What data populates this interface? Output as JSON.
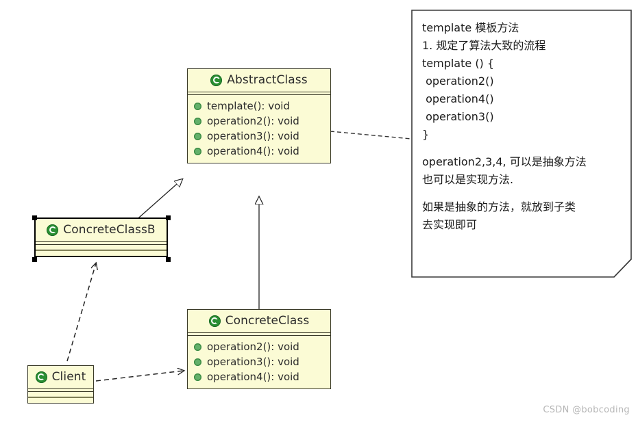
{
  "diagram": {
    "type": "uml-class-diagram",
    "title": "Template Method Pattern UML"
  },
  "classes": [
    {
      "id": "abstract-class",
      "name": "AbstractClass",
      "icon": "class-c-icon",
      "selected": false,
      "members": [
        "template(): void",
        "operation2(): void",
        "operation3(): void",
        "operation4(): void"
      ]
    },
    {
      "id": "concrete-class-b",
      "name": "ConcreteClassB",
      "icon": "class-c-icon",
      "selected": true,
      "members": []
    },
    {
      "id": "concrete-class",
      "name": "ConcreteClass",
      "icon": "class-c-icon",
      "selected": false,
      "members": [
        "operation2(): void",
        "operation3(): void",
        "operation4(): void"
      ]
    },
    {
      "id": "client",
      "name": "Client",
      "icon": "class-c-icon",
      "selected": false,
      "members": []
    }
  ],
  "note": {
    "id": "template-note",
    "lines": [
      "template 模板方法",
      "1. 规定了算法大致的流程",
      "template () {",
      " operation2()",
      " operation4()",
      " operation3()",
      "}",
      "",
      "operation2,3,4, 可以是抽象方法",
      "也可以是实现方法.",
      "",
      "如果是抽象的方法，就放到子类",
      "去实现即可"
    ]
  },
  "relations": [
    {
      "id": "b-extends-abstract",
      "kind": "generalization",
      "from": "ConcreteClassB",
      "to": "AbstractClass",
      "style": "solid-hollow-triangle"
    },
    {
      "id": "concrete-extends-abstract",
      "kind": "generalization",
      "from": "ConcreteClass",
      "to": "AbstractClass",
      "style": "solid-hollow-triangle"
    },
    {
      "id": "client-uses-b",
      "kind": "dependency",
      "from": "Client",
      "to": "ConcreteClassB",
      "style": "dashed-open-arrow"
    },
    {
      "id": "client-uses-concrete",
      "kind": "dependency",
      "from": "Client",
      "to": "ConcreteClass",
      "style": "dashed-open-arrow"
    },
    {
      "id": "abstract-note-anchor",
      "kind": "note-anchor",
      "from": "AbstractClass",
      "to": "template-note",
      "style": "dashed-line"
    }
  ],
  "watermark": {
    "text": "CSDN @bobcoding"
  },
  "colors": {
    "class_fill": "#fbfbd5",
    "class_border": "#3a3a28",
    "icon_green": "#2a8f33",
    "bullet_green": "#63b06a",
    "note_fill": "#ffffff",
    "line_black": "#222222",
    "watermark_gray": "#b6b6b6"
  }
}
